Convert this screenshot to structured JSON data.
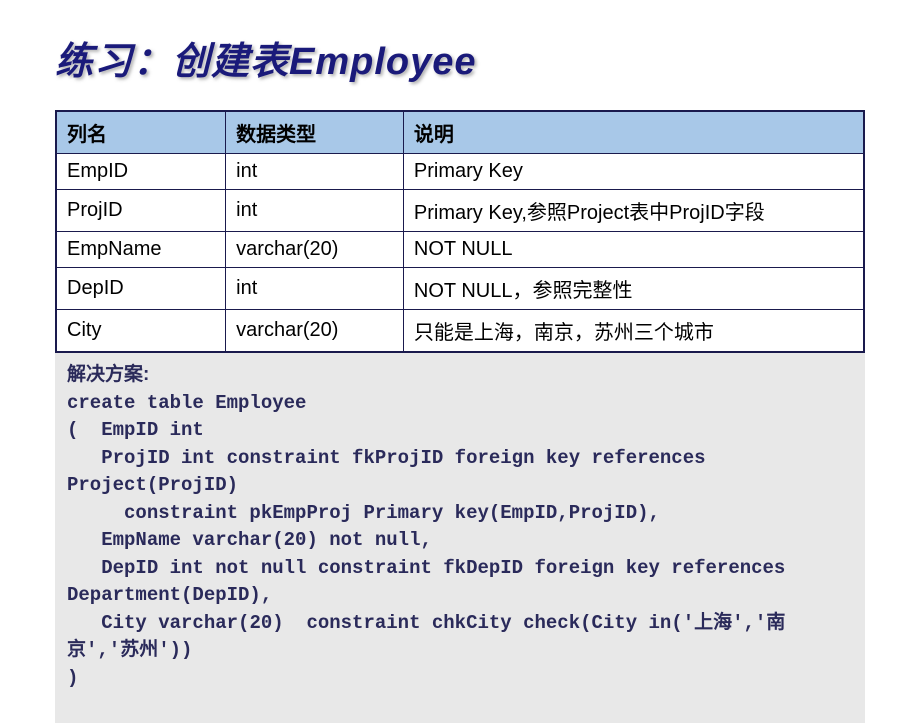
{
  "title": "练习：创建表Employee",
  "table": {
    "headers": [
      "列名",
      "数据类型",
      "说明"
    ],
    "rows": [
      [
        "EmpID",
        "int",
        "Primary Key"
      ],
      [
        "ProjID",
        "int",
        "Primary Key,参照Project表中ProjID字段"
      ],
      [
        "EmpName",
        "varchar(20)",
        "NOT NULL"
      ],
      [
        "DepID",
        "int",
        "NOT NULL，参照完整性"
      ],
      [
        "City",
        "varchar(20)",
        "只能是上海，南京，苏州三个城市"
      ]
    ]
  },
  "solution_label": "解决方案:",
  "code_lines": [
    "create table Employee",
    "(  EmpID int",
    "   ProjID int constraint fkProjID foreign key references Project(ProjID)",
    "     constraint pkEmpProj Primary key(EmpID,ProjID),",
    "   EmpName varchar(20) not null,",
    "   DepID int not null constraint fkDepID foreign key references Department(DepID),",
    "   City varchar(20)  constraint chkCity check(City in('上海','南京','苏州'))",
    ")"
  ]
}
